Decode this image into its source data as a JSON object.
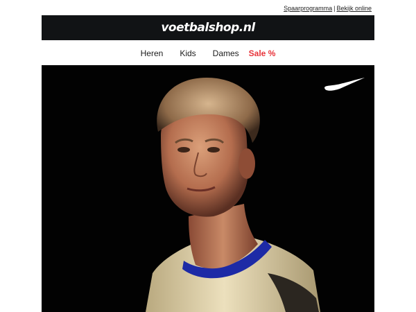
{
  "top_links": {
    "savings_program": "Spaarprogramma",
    "separator": "|",
    "view_online": "Bekijk online"
  },
  "header": {
    "logo_text": "voetbalshop.nl",
    "background": "#111315"
  },
  "nav": {
    "items": [
      {
        "label": "Heren"
      },
      {
        "label": "Kids"
      },
      {
        "label": "Dames"
      },
      {
        "label": "Sale %",
        "color": "#e8343a"
      }
    ]
  },
  "hero": {
    "background": "#020202",
    "brand_logo": "nike-swoosh-icon",
    "image": "football-player-portrait"
  }
}
